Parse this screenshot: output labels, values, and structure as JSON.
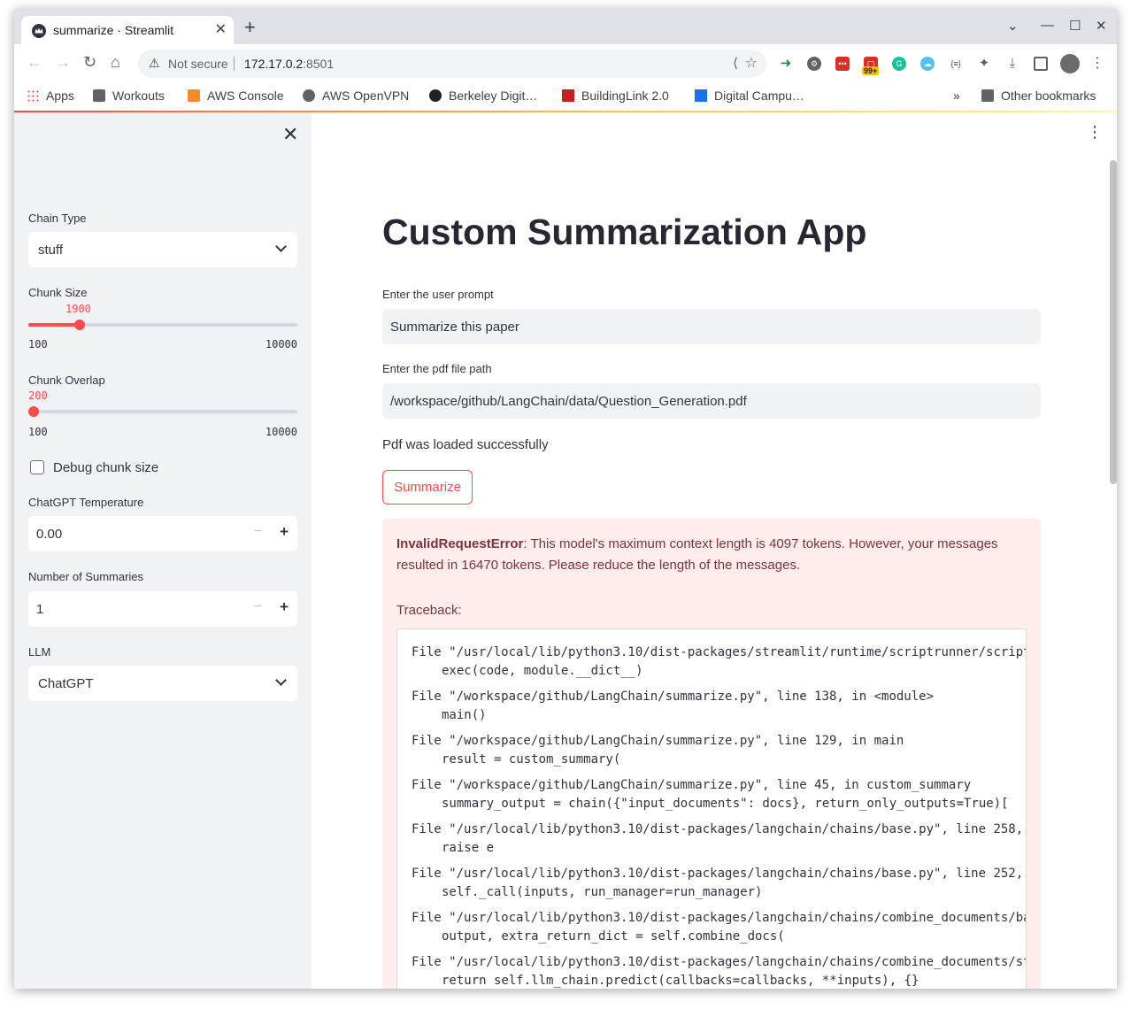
{
  "browser": {
    "tab_title": "summarize · Streamlit",
    "tab_close": "✕",
    "new_tab": "+",
    "window_controls": {
      "minimize": "—",
      "maximize": "☐",
      "close": "✕",
      "tab_list": "⌄"
    },
    "nav": {
      "back": "←",
      "forward": "→",
      "reload": "↻",
      "home": "⌂"
    },
    "security_label": "Not secure",
    "url_host": "172.17.0.2",
    "url_port": ":8501",
    "extension_badge": "99+",
    "bookmarks": [
      "Apps",
      "Workouts",
      "AWS Console",
      "AWS OpenVPN",
      "Berkeley Digit…",
      "BuildingLink 2.0",
      "Digital Campu…"
    ],
    "bookmarks_overflow": "»",
    "other_bookmarks": "Other bookmarks"
  },
  "sidebar": {
    "close_label": "✕",
    "chain_type": {
      "label": "Chain Type",
      "value": "stuff"
    },
    "chunk_size": {
      "label": "Chunk Size",
      "value": "1900",
      "min": "100",
      "max": "10000",
      "fraction": 0.1818
    },
    "chunk_overlap": {
      "label": "Chunk Overlap",
      "value": "200",
      "min": "100",
      "max": "10000",
      "fraction": 0.0101
    },
    "debug_checkbox": {
      "label": "Debug chunk size",
      "checked": false
    },
    "temperature": {
      "label": "ChatGPT Temperature",
      "value": "0.00",
      "minus": "−",
      "plus": "+"
    },
    "num_summaries": {
      "label": "Number of Summaries",
      "value": "1",
      "minus": "−",
      "plus": "+"
    },
    "llm": {
      "label": "LLM",
      "value": "ChatGPT"
    }
  },
  "main": {
    "menu": "⋮",
    "title": "Custom Summarization App",
    "prompt": {
      "label": "Enter the user prompt",
      "value": "Summarize this paper"
    },
    "pdf_path": {
      "label": "Enter the pdf file path",
      "value": "/workspace/github/LangChain/data/Question_Generation.pdf"
    },
    "status": "Pdf was loaded successfully",
    "summarize_button": "Summarize",
    "error": {
      "type": "InvalidRequestError",
      "message": ": This model's maximum context length is 4097 tokens. However, your messages resulted in 16470 tokens. Please reduce the length of the messages.",
      "traceback_label": "Traceback:",
      "frames": [
        {
          "file": "File \"/usr/local/lib/python3.10/dist-packages/streamlit/runtime/scriptrunner/script",
          "code": "exec(code, module.__dict__)"
        },
        {
          "file": "File \"/workspace/github/LangChain/summarize.py\", line 138, in <module>",
          "code": "main()"
        },
        {
          "file": "File \"/workspace/github/LangChain/summarize.py\", line 129, in main",
          "code": "result = custom_summary("
        },
        {
          "file": "File \"/workspace/github/LangChain/summarize.py\", line 45, in custom_summary",
          "code": "summary_output = chain({\"input_documents\": docs}, return_only_outputs=True)["
        },
        {
          "file": "File \"/usr/local/lib/python3.10/dist-packages/langchain/chains/base.py\", line 258,",
          "code": "raise e"
        },
        {
          "file": "File \"/usr/local/lib/python3.10/dist-packages/langchain/chains/base.py\", line 252,",
          "code": "self._call(inputs, run_manager=run_manager)"
        },
        {
          "file": "File \"/usr/local/lib/python3.10/dist-packages/langchain/chains/combine_documents/ba",
          "code": "output, extra_return_dict = self.combine_docs("
        },
        {
          "file": "File \"/usr/local/lib/python3.10/dist-packages/langchain/chains/combine_documents/st",
          "code": "return self.llm_chain.predict(callbacks=callbacks, **inputs), {}"
        }
      ]
    }
  },
  "colors": {
    "accent": "#ff4b4b",
    "sidebar_bg": "#f0f2f6",
    "error_bg": "#ffeced",
    "error_text": "#7d353b"
  }
}
